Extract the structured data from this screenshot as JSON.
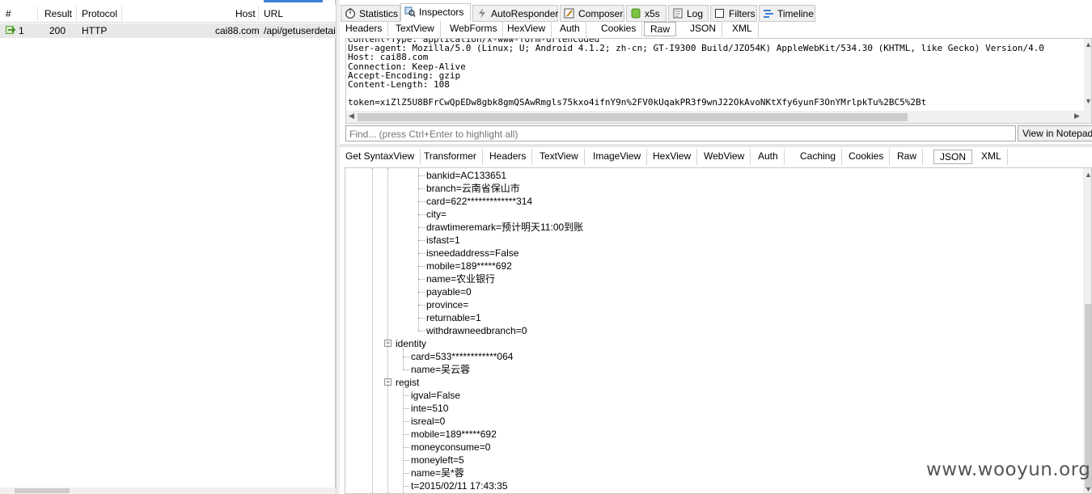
{
  "sessions": {
    "columns": [
      "#",
      "Result",
      "Protocol",
      "Host",
      "URL"
    ],
    "rows": [
      {
        "num": "1",
        "result": "200",
        "protocol": "HTTP",
        "host": "cai88.com",
        "url": "/api/getuserdetail."
      }
    ]
  },
  "main_tabs": [
    "Statistics",
    "Inspectors",
    "AutoResponder",
    "Composer",
    "x5s",
    "Log",
    "Filters",
    "Timeline"
  ],
  "request_tabs": [
    "Headers",
    "TextView",
    "WebForms",
    "HexView",
    "Auth",
    "Cookies",
    "Raw",
    "JSON",
    "XML"
  ],
  "raw_lines": [
    "Content-Type: application/x-www-form-urlencoded",
    "User-agent: Mozilla/5.0 (Linux; U; Android 4.1.2; zh-cn; GT-I9300 Build/JZO54K) AppleWebKit/534.30 (KHTML, like Gecko) Version/4.0",
    "Host: cai88.com",
    "Connection: Keep-Alive",
    "Accept-Encoding: gzip",
    "Content-Length: 108",
    "",
    "token=xiZlZ5U8BFrCwQpEDw8gbk8gmQSAwRmgls75kxo4ifnY9n%2FV0kUqakPR3f9wnJ22OkAvoNKtXfy6yunF3OnYMrlpkTu%2BC5%2Bt"
  ],
  "find": {
    "placeholder": "Find... (press Ctrl+Enter to highlight all)",
    "button": "View in Notepad"
  },
  "response_tabs": [
    "Get SyntaxView",
    "Transformer",
    "Headers",
    "TextView",
    "ImageView",
    "HexView",
    "WebView",
    "Auth",
    "Caching",
    "Cookies",
    "Raw",
    "JSON",
    "XML"
  ],
  "tree": {
    "bank_items": [
      "bankid=AC133651",
      "branch=云南省保山市",
      "card=622*************314",
      "city=",
      "drawtimeremark=预计明天11:00到账",
      "isfast=1",
      "isneedaddress=False",
      "mobile=189*****692",
      "name=农业银行",
      "payable=0",
      "province=",
      "returnable=1",
      "withdrawneedbranch=0"
    ],
    "identity_label": "identity",
    "identity_items": [
      "card=533************064",
      "name=吴云蓉"
    ],
    "regist_label": "regist",
    "regist_items": [
      "igval=False",
      "inte=510",
      "isreal=0",
      "mobile=189*****692",
      "moneyconsume=0",
      "moneyleft=5",
      "name=吴*蓉",
      "t=2015/02/11 17:43:35"
    ]
  },
  "watermark": "www.wooyun.org",
  "colors": {
    "accent": "#3c7fd6",
    "row_selected": "#e8e8e8",
    "icon_green": "#5aa02c"
  }
}
